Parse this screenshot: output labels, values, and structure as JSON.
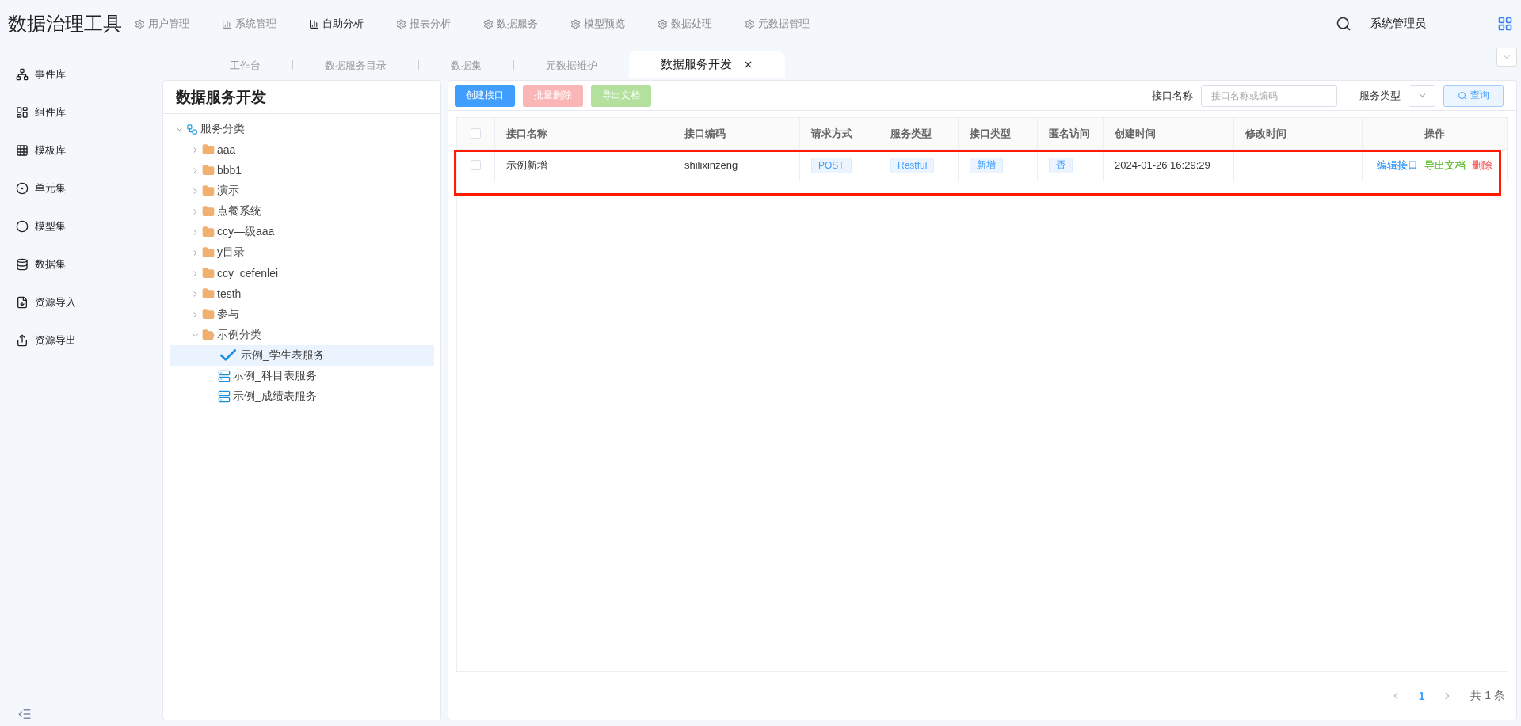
{
  "app_title": "数据治理工具",
  "nav": [
    {
      "label": "用户管理",
      "selected": false
    },
    {
      "label": "系统管理",
      "selected": false
    },
    {
      "label": "自助分析",
      "selected": true
    },
    {
      "label": "报表分析",
      "selected": false
    },
    {
      "label": "数据服务",
      "selected": false
    },
    {
      "label": "模型预览",
      "selected": false
    },
    {
      "label": "数据处理",
      "selected": false
    },
    {
      "label": "元数据管理",
      "selected": false
    }
  ],
  "user": "系统管理员",
  "sidebar": {
    "items": [
      {
        "label": "事件库"
      },
      {
        "label": "组件库"
      },
      {
        "label": "模板库"
      },
      {
        "label": "单元集"
      },
      {
        "label": "模型集"
      },
      {
        "label": "数据集"
      },
      {
        "label": "资源导入"
      },
      {
        "label": "资源导出"
      }
    ]
  },
  "tabs": [
    {
      "label": "工作台",
      "selected": false
    },
    {
      "label": "数据服务目录",
      "selected": false
    },
    {
      "label": "数据集",
      "selected": false
    },
    {
      "label": "元数据维护",
      "selected": false
    },
    {
      "label": "数据服务开发",
      "selected": true
    }
  ],
  "tree": {
    "title": "数据服务开发",
    "items": [
      {
        "label": "服务分类",
        "kind": "root",
        "expanded": true,
        "children": [
          {
            "label": "aaa",
            "kind": "folder",
            "expanded": false
          },
          {
            "label": "bbb1",
            "kind": "folder",
            "expanded": false
          },
          {
            "label": "演示",
            "kind": "folder",
            "expanded": false
          },
          {
            "label": "点餐系统",
            "kind": "folder",
            "expanded": false
          },
          {
            "label": "ccy—级aaa",
            "kind": "folder",
            "expanded": false
          },
          {
            "label": "y目录",
            "kind": "folder",
            "expanded": false
          },
          {
            "label": "ccy_cefenlei",
            "kind": "folder",
            "expanded": false
          },
          {
            "label": "testh",
            "kind": "folder",
            "expanded": false
          },
          {
            "label": "参与",
            "kind": "folder",
            "expanded": false
          },
          {
            "label": "示例分类",
            "kind": "folder",
            "expanded": true,
            "children": [
              {
                "label": "示例_学生表服务",
                "kind": "service",
                "selected": true
              },
              {
                "label": "示例_科目表服务",
                "kind": "service",
                "selected": false
              },
              {
                "label": "示例_成绩表服务",
                "kind": "service",
                "selected": false
              }
            ]
          }
        ]
      }
    ]
  },
  "toolbar": {
    "buttons": [
      {
        "label": "创建接口",
        "kind": "primary",
        "disabled": false
      },
      {
        "label": "批量删除",
        "kind": "danger",
        "disabled": true
      },
      {
        "label": "导出文档",
        "kind": "success",
        "disabled": true
      }
    ],
    "name_label": "接口名称",
    "name_placeholder": "接口名称或编码",
    "type_label": "服务类型",
    "search_button": "查询"
  },
  "table": {
    "all_checked": false,
    "columns": [
      "接口名称",
      "接口编码",
      "请求方式",
      "服务类型",
      "接口类型",
      "匿名访问",
      "创建时间",
      "修改时间",
      "操作"
    ],
    "rows": [
      {
        "checked": false,
        "highlighted": true,
        "name": "示例新增",
        "code": "shilixinzeng",
        "method": "POST",
        "service_type": "Restful",
        "interface_type": "新增",
        "anonymous": "否",
        "created": "2024-01-26 16:29:29",
        "actions": [
          {
            "label": "编辑接口",
            "color": "#409eff"
          },
          {
            "label": "导出文档",
            "color": "#67c23a"
          },
          {
            "label": "删除",
            "color": "#f56c6c"
          }
        ]
      }
    ]
  },
  "pagination": {
    "pages": [
      {
        "label": "1",
        "selected": true
      }
    ],
    "total": "共 1 条"
  }
}
